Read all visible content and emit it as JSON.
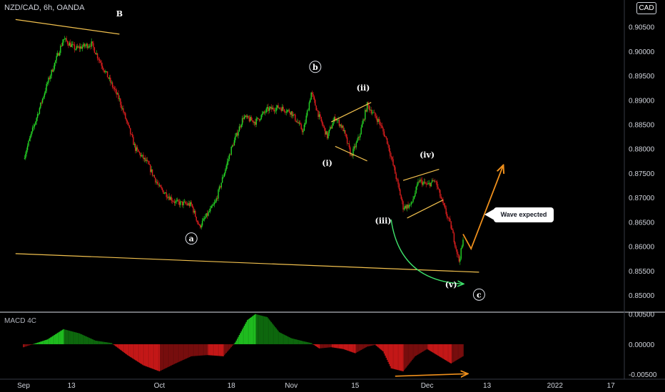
{
  "header": {
    "symbol": "NZD/CAD, 6h, OANDA",
    "currency_badge": "CAD"
  },
  "macd": {
    "title": "MACD 4C"
  },
  "callout": {
    "text": "Wave expected"
  },
  "colors": {
    "background": "#000000",
    "bull": "#26d626",
    "bear": "#e01e1e",
    "trend_line": "#f2c14e",
    "projection": "#f0901c",
    "curve_arrow": "#3ee06a",
    "axis_text": "#d1d4dc"
  },
  "chart_data": [
    {
      "type": "candlestick",
      "title": "NZD/CAD, 6h, OANDA",
      "ylim": [
        0.8465,
        0.9105
      ],
      "y_ticks": [
        "0.85000",
        "0.85500",
        "0.86000",
        "0.86500",
        "0.87000",
        "0.87500",
        "0.88000",
        "0.88500",
        "0.89000",
        "0.89500",
        "0.90000",
        "0.90500"
      ],
      "y_tick_values": [
        0.85,
        0.855,
        0.86,
        0.865,
        0.87,
        0.875,
        0.88,
        0.885,
        0.89,
        0.895,
        0.9,
        0.905
      ],
      "x_ticks": [
        "Sep",
        "13",
        "Oct",
        "18",
        "Nov",
        "15",
        "Dec",
        "13",
        "2022",
        "17"
      ],
      "x_tick_index": [
        0,
        12,
        34,
        52,
        67,
        83,
        101,
        116,
        133,
        147
      ],
      "price_path": [
        [
          0,
          0.878
        ],
        [
          6,
          0.8935
        ],
        [
          10,
          0.9025
        ],
        [
          13,
          0.9005
        ],
        [
          17,
          0.9015
        ],
        [
          20,
          0.8965
        ],
        [
          24,
          0.89
        ],
        [
          28,
          0.88
        ],
        [
          31,
          0.877
        ],
        [
          34,
          0.872
        ],
        [
          38,
          0.869
        ],
        [
          42,
          0.8685
        ],
        [
          44,
          0.864
        ],
        [
          48,
          0.869
        ],
        [
          52,
          0.88
        ],
        [
          55,
          0.8865
        ],
        [
          58,
          0.8855
        ],
        [
          61,
          0.888
        ],
        [
          64,
          0.8885
        ],
        [
          67,
          0.8875
        ],
        [
          70,
          0.8835
        ],
        [
          72,
          0.8915
        ],
        [
          74,
          0.8865
        ],
        [
          76,
          0.8825
        ],
        [
          78,
          0.8865
        ],
        [
          80,
          0.884
        ],
        [
          82,
          0.8785
        ],
        [
          84,
          0.8825
        ],
        [
          86,
          0.889
        ],
        [
          89,
          0.8855
        ],
        [
          91,
          0.8815
        ],
        [
          93,
          0.875
        ],
        [
          95,
          0.868
        ],
        [
          97,
          0.8685
        ],
        [
          99,
          0.8735
        ],
        [
          101,
          0.8725
        ],
        [
          103,
          0.8735
        ],
        [
          105,
          0.8685
        ],
        [
          107,
          0.864
        ],
        [
          109,
          0.857
        ],
        [
          110,
          0.861
        ]
      ],
      "wave_labels": [
        {
          "text": "B",
          "index": 24,
          "price": 0.9077
        },
        {
          "text": "a",
          "index": 42,
          "price": 0.8616,
          "circled": true
        },
        {
          "text": "b",
          "index": 73,
          "price": 0.8968,
          "circled": true
        },
        {
          "text": "(i)",
          "index": 76,
          "price": 0.8771
        },
        {
          "text": "(ii)",
          "index": 85,
          "price": 0.8925
        },
        {
          "text": "(iii)",
          "index": 90,
          "price": 0.8653
        },
        {
          "text": "(iv)",
          "index": 101,
          "price": 0.8788
        },
        {
          "text": "(v)",
          "index": 107,
          "price": 0.8522
        },
        {
          "text": "c",
          "index": 114,
          "price": 0.8501,
          "circled": true
        }
      ],
      "trend_lines": [
        {
          "from": [
            -2,
            0.9065
          ],
          "to": [
            24,
            0.9035
          ]
        },
        {
          "from": [
            -2,
            0.8585
          ],
          "to": [
            114,
            0.8547
          ]
        }
      ],
      "channels": [
        {
          "upper": [
            [
              77,
              0.8855
            ],
            [
              87,
              0.8895
            ]
          ],
          "lower": [
            [
              78,
              0.8805
            ],
            [
              86,
              0.8775
            ]
          ]
        },
        {
          "upper": [
            [
              95,
              0.8735
            ],
            [
              104,
              0.8758
            ]
          ],
          "lower": [
            [
              96,
              0.8658
            ],
            [
              105,
              0.8695
            ]
          ]
        }
      ],
      "projection": [
        [
          110,
          0.8625
        ],
        [
          112,
          0.8595
        ],
        [
          120,
          0.8765
        ]
      ],
      "curve_arrow": {
        "from": [
          92,
          0.8655
        ],
        "to": [
          110,
          0.8523
        ]
      }
    },
    {
      "type": "histogram",
      "title": "MACD 4C",
      "ylim": [
        -0.0058,
        0.0052
      ],
      "y_ticks": [
        "0.00500",
        "0.00000",
        "-0.00500"
      ],
      "y_tick_values": [
        0.005,
        0.0,
        -0.005
      ],
      "path": [
        [
          0,
          -0.0005
        ],
        [
          6,
          0.0008
        ],
        [
          10,
          0.0025
        ],
        [
          14,
          0.0018
        ],
        [
          18,
          0.0006
        ],
        [
          22,
          0.0002
        ],
        [
          26,
          -0.0018
        ],
        [
          30,
          -0.0035
        ],
        [
          34,
          -0.0045
        ],
        [
          38,
          -0.0032
        ],
        [
          42,
          -0.002
        ],
        [
          46,
          -0.0018
        ],
        [
          50,
          -0.002
        ],
        [
          53,
          0.0003
        ],
        [
          56,
          0.004
        ],
        [
          58,
          0.005
        ],
        [
          61,
          0.0045
        ],
        [
          64,
          0.002
        ],
        [
          67,
          0.001
        ],
        [
          70,
          0.0005
        ],
        [
          72,
          0.0002
        ],
        [
          74,
          -0.0007
        ],
        [
          77,
          -0.0005
        ],
        [
          80,
          -0.0008
        ],
        [
          83,
          -0.0015
        ],
        [
          86,
          -0.0004
        ],
        [
          88,
          -0.0001
        ],
        [
          90,
          -0.0012
        ],
        [
          92,
          -0.004
        ],
        [
          95,
          -0.0045
        ],
        [
          98,
          -0.002
        ],
        [
          101,
          -0.0008
        ],
        [
          104,
          -0.002
        ],
        [
          107,
          -0.0032
        ],
        [
          110,
          -0.002
        ]
      ],
      "divergence_line": [
        [
          93,
          -0.0053
        ],
        [
          111,
          -0.0049
        ]
      ]
    }
  ]
}
